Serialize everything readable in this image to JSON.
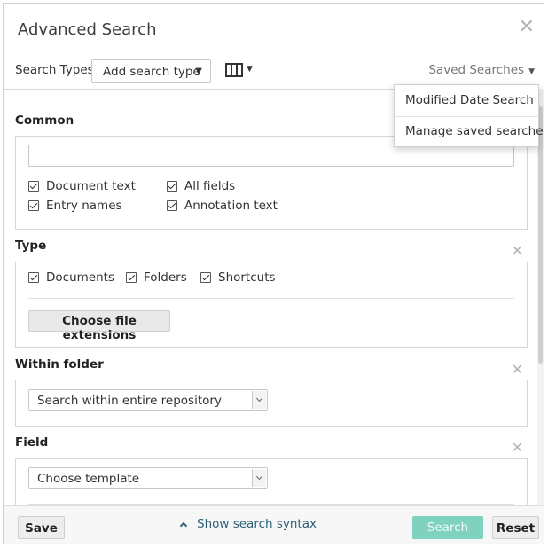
{
  "dialog": {
    "title": "Advanced Search",
    "close_icon": "close-icon"
  },
  "toolbar": {
    "search_types_label": "Search Types",
    "add_search_type": "Add search type",
    "columns_icon": "columns-icon",
    "saved_searches_label": "Saved Searches"
  },
  "saved_menu": {
    "items": [
      {
        "label": "Modified Date Search"
      },
      {
        "label": "Manage saved searches"
      }
    ]
  },
  "sections": {
    "common": {
      "title": "Common",
      "search_value": "",
      "checkboxes": [
        {
          "label": "Document text",
          "checked": true
        },
        {
          "label": "All fields",
          "checked": true
        },
        {
          "label": "Entry names",
          "checked": true
        },
        {
          "label": "Annotation text",
          "checked": true
        }
      ]
    },
    "type": {
      "title": "Type",
      "checkboxes": [
        {
          "label": "Documents",
          "checked": true
        },
        {
          "label": "Folders",
          "checked": true
        },
        {
          "label": "Shortcuts",
          "checked": true
        }
      ],
      "file_ext_button": "Choose file extensions"
    },
    "folder": {
      "title": "Within folder",
      "selected": "Search within entire repository"
    },
    "field": {
      "title": "Field",
      "selected": "Choose template"
    }
  },
  "footer": {
    "save": "Save",
    "show_syntax": "Show search syntax",
    "search": "Search",
    "reset": "Reset"
  },
  "colors": {
    "search_button": "#7fd1c0",
    "link": "#2e5f7a"
  }
}
